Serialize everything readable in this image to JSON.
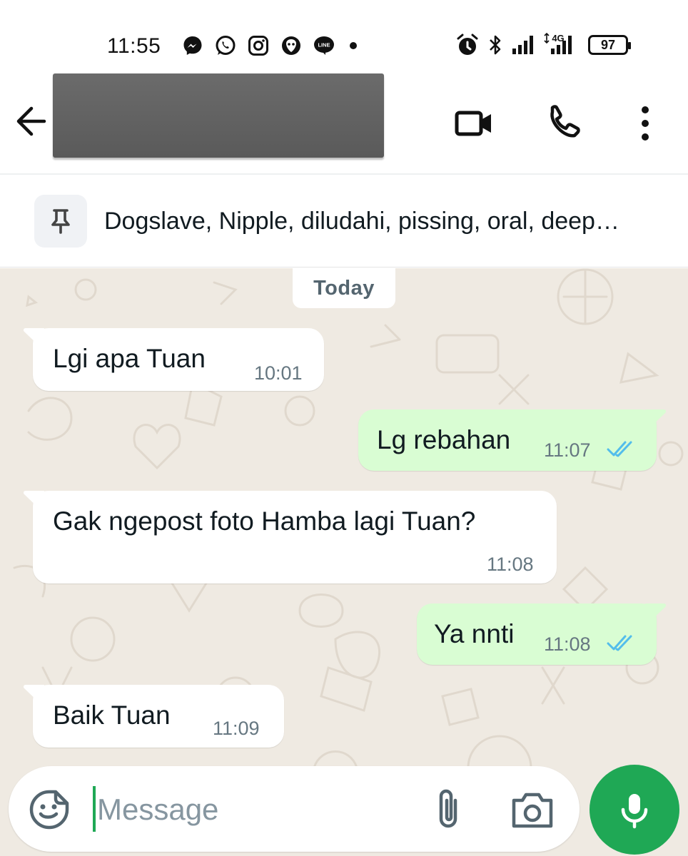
{
  "status_bar": {
    "time": "11:55",
    "notification_icons": [
      "messenger-icon",
      "whatsapp-icon",
      "instagram-icon",
      "grindr-icon",
      "line-icon"
    ],
    "line_label": "LINE",
    "network_label": "4G",
    "battery": "97"
  },
  "header": {
    "contact_name": "",
    "actions": [
      "video-call-icon",
      "phone-icon",
      "more-vert-icon"
    ]
  },
  "pinned": {
    "icon": "pin-icon",
    "text": "Dogslave, Nipple, diludahi, pissing, oral, deep…"
  },
  "chat": {
    "date_label": "Today",
    "messages": [
      {
        "direction": "in",
        "text": "Lgi apa Tuan",
        "time": "10:01"
      },
      {
        "direction": "out",
        "text": "Lg rebahan",
        "time": "11:07",
        "read": true
      },
      {
        "direction": "in",
        "text": "Gak ngepost foto Hamba lagi Tuan?",
        "time": "11:08"
      },
      {
        "direction": "out",
        "text": "Ya nnti",
        "time": "11:08",
        "read": true
      },
      {
        "direction": "in",
        "text": "Baik Tuan",
        "time": "11:09"
      }
    ]
  },
  "composer": {
    "placeholder": "Message",
    "icons": [
      "sticker-icon",
      "attach-icon",
      "camera-icon",
      "mic-icon"
    ]
  },
  "colors": {
    "accent": "#1fa855",
    "outgoing_bubble": "#d9fdd3",
    "incoming_bubble": "#ffffff",
    "chat_background": "#efeae2",
    "read_ticks": "#53bdeb"
  }
}
